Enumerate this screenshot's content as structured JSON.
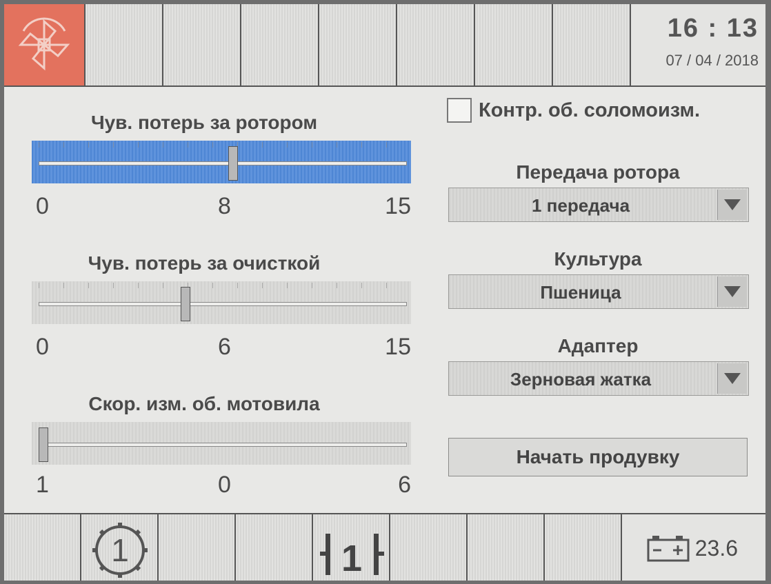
{
  "header": {
    "time": "16 : 13",
    "date": "07 / 04 / 2018"
  },
  "sliders": [
    {
      "title": "Чув. потерь за ротором",
      "min": "0",
      "value": "8",
      "max": "15",
      "level": 0.533,
      "active": true
    },
    {
      "title": "Чув. потерь за очисткой",
      "min": "0",
      "value": "6",
      "max": "15",
      "level": 0.4,
      "active": false
    },
    {
      "title": "Скор. изм. об. мотовила",
      "min": "1",
      "value": "0",
      "max": "6",
      "level": 0.0,
      "active": false
    }
  ],
  "right_panel": {
    "checkbox_label": "Контр. об. соломоизм.",
    "checkbox_checked": false,
    "rotor_gear_label": "Передача ротора",
    "rotor_gear_value": "1 передача",
    "crop_label": "Культура",
    "crop_value": "Пшеница",
    "adapter_label": "Адаптер",
    "adapter_value": "Зерновая жатка",
    "purge_button": "Начать продувку"
  },
  "footer": {
    "gear_number": "1",
    "battery_voltage": "23.6"
  },
  "icons": {
    "logo": "pinwheel-logo-icon",
    "gear": "gear-1-icon",
    "range": "range-1-icon",
    "battery": "battery-icon"
  },
  "colors": {
    "logo_bg": "#e3725e",
    "active_slider": "#5a8fda"
  }
}
